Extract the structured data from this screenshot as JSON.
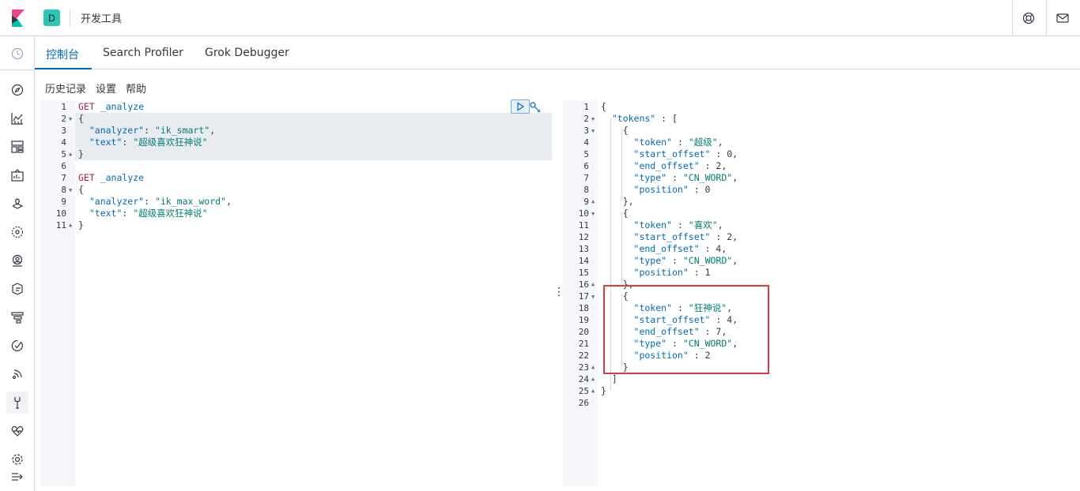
{
  "header": {
    "space_initial": "D",
    "breadcrumb": "开发工具"
  },
  "tabs": [
    {
      "label": "控制台",
      "active": true
    },
    {
      "label": "Search Profiler",
      "active": false
    },
    {
      "label": "Grok Debugger",
      "active": false
    }
  ],
  "submenu": {
    "history": "历史记录",
    "settings": "设置",
    "help": "帮助"
  },
  "nav_icons": [
    "clock-icon",
    "compass-icon",
    "chart-icon",
    "dashboard-icon",
    "canvas-icon",
    "maps-icon",
    "ml-icon",
    "infra-icon",
    "logs-icon",
    "apm-icon",
    "uptime-icon",
    "siem-icon",
    "devtools-icon",
    "monitoring-icon",
    "management-icon",
    "collapse-icon"
  ],
  "request_editor": {
    "line_numbers": [
      "1",
      "2",
      "3",
      "4",
      "5",
      "6",
      "7",
      "8",
      "9",
      "10",
      "11"
    ],
    "lines": [
      [
        {
          "t": "GET",
          "c": "method"
        },
        {
          "t": " _analyze",
          "c": "url"
        }
      ],
      [
        {
          "t": "{",
          "c": "punc"
        }
      ],
      [
        {
          "t": "  \"analyzer\"",
          "c": "key"
        },
        {
          "t": ": ",
          "c": "punc"
        },
        {
          "t": "\"ik_smart\"",
          "c": "str"
        },
        {
          "t": ",",
          "c": "punc"
        }
      ],
      [
        {
          "t": "  \"text\"",
          "c": "key"
        },
        {
          "t": ": ",
          "c": "punc"
        },
        {
          "t": "\"超级喜欢狂神说\"",
          "c": "str"
        }
      ],
      [
        {
          "t": "}",
          "c": "punc"
        }
      ],
      [],
      [
        {
          "t": "GET",
          "c": "method"
        },
        {
          "t": " _analyze",
          "c": "url"
        }
      ],
      [
        {
          "t": "{",
          "c": "punc"
        }
      ],
      [
        {
          "t": "  \"analyzer\"",
          "c": "key"
        },
        {
          "t": ": ",
          "c": "punc"
        },
        {
          "t": "\"ik_max_word\"",
          "c": "str"
        },
        {
          "t": ",",
          "c": "punc"
        }
      ],
      [
        {
          "t": "  \"text\"",
          "c": "key"
        },
        {
          "t": ": ",
          "c": "punc"
        },
        {
          "t": "\"超级喜欢狂神说\"",
          "c": "str"
        }
      ],
      [
        {
          "t": "}",
          "c": "punc"
        }
      ]
    ],
    "folds": {
      "2": "down",
      "5": "up",
      "8": "down",
      "11": "up"
    }
  },
  "response_editor": {
    "line_numbers": [
      "1",
      "2",
      "3",
      "4",
      "5",
      "6",
      "7",
      "8",
      "9",
      "10",
      "11",
      "12",
      "13",
      "14",
      "15",
      "16",
      "17",
      "18",
      "19",
      "20",
      "21",
      "22",
      "23",
      "24",
      "25",
      "26"
    ],
    "lines": [
      [
        {
          "t": "{",
          "c": "punc"
        }
      ],
      [
        {
          "t": "  \"tokens\"",
          "c": "key"
        },
        {
          "t": " : [",
          "c": "punc"
        }
      ],
      [
        {
          "t": "    {",
          "c": "punc"
        }
      ],
      [
        {
          "t": "      \"token\"",
          "c": "key"
        },
        {
          "t": " : ",
          "c": "punc"
        },
        {
          "t": "\"超级\"",
          "c": "str"
        },
        {
          "t": ",",
          "c": "punc"
        }
      ],
      [
        {
          "t": "      \"start_offset\"",
          "c": "key"
        },
        {
          "t": " : 0,",
          "c": "num"
        }
      ],
      [
        {
          "t": "      \"end_offset\"",
          "c": "key"
        },
        {
          "t": " : 2,",
          "c": "num"
        }
      ],
      [
        {
          "t": "      \"type\"",
          "c": "key"
        },
        {
          "t": " : ",
          "c": "punc"
        },
        {
          "t": "\"CN_WORD\"",
          "c": "str"
        },
        {
          "t": ",",
          "c": "punc"
        }
      ],
      [
        {
          "t": "      \"position\"",
          "c": "key"
        },
        {
          "t": " : 0",
          "c": "num"
        }
      ],
      [
        {
          "t": "    },",
          "c": "punc"
        }
      ],
      [
        {
          "t": "    {",
          "c": "punc"
        }
      ],
      [
        {
          "t": "      \"token\"",
          "c": "key"
        },
        {
          "t": " : ",
          "c": "punc"
        },
        {
          "t": "\"喜欢\"",
          "c": "str"
        },
        {
          "t": ",",
          "c": "punc"
        }
      ],
      [
        {
          "t": "      \"start_offset\"",
          "c": "key"
        },
        {
          "t": " : 2,",
          "c": "num"
        }
      ],
      [
        {
          "t": "      \"end_offset\"",
          "c": "key"
        },
        {
          "t": " : 4,",
          "c": "num"
        }
      ],
      [
        {
          "t": "      \"type\"",
          "c": "key"
        },
        {
          "t": " : ",
          "c": "punc"
        },
        {
          "t": "\"CN_WORD\"",
          "c": "str"
        },
        {
          "t": ",",
          "c": "punc"
        }
      ],
      [
        {
          "t": "      \"position\"",
          "c": "key"
        },
        {
          "t": " : 1",
          "c": "num"
        }
      ],
      [
        {
          "t": "    },",
          "c": "punc"
        }
      ],
      [
        {
          "t": "    {",
          "c": "punc"
        }
      ],
      [
        {
          "t": "      \"token\"",
          "c": "key"
        },
        {
          "t": " : ",
          "c": "punc"
        },
        {
          "t": "\"狂神说\"",
          "c": "str"
        },
        {
          "t": ",",
          "c": "punc"
        }
      ],
      [
        {
          "t": "      \"start_offset\"",
          "c": "key"
        },
        {
          "t": " : 4,",
          "c": "num"
        }
      ],
      [
        {
          "t": "      \"end_offset\"",
          "c": "key"
        },
        {
          "t": " : 7,",
          "c": "num"
        }
      ],
      [
        {
          "t": "      \"type\"",
          "c": "key"
        },
        {
          "t": " : ",
          "c": "punc"
        },
        {
          "t": "\"CN_WORD\"",
          "c": "str"
        },
        {
          "t": ",",
          "c": "punc"
        }
      ],
      [
        {
          "t": "      \"position\"",
          "c": "key"
        },
        {
          "t": " : 2",
          "c": "num"
        }
      ],
      [
        {
          "t": "    }",
          "c": "punc"
        }
      ],
      [
        {
          "t": "  ]",
          "c": "punc"
        }
      ],
      [
        {
          "t": "}",
          "c": "punc"
        }
      ],
      []
    ],
    "folds": {
      "2": "down",
      "3": "down",
      "9": "up",
      "10": "down",
      "16": "up",
      "17": "down",
      "23": "up",
      "24": "up",
      "25": "up"
    }
  },
  "colors": {
    "accent": "#006bb4",
    "highlight_box": "#e0393e",
    "space_badge": "#2ec4b6"
  }
}
